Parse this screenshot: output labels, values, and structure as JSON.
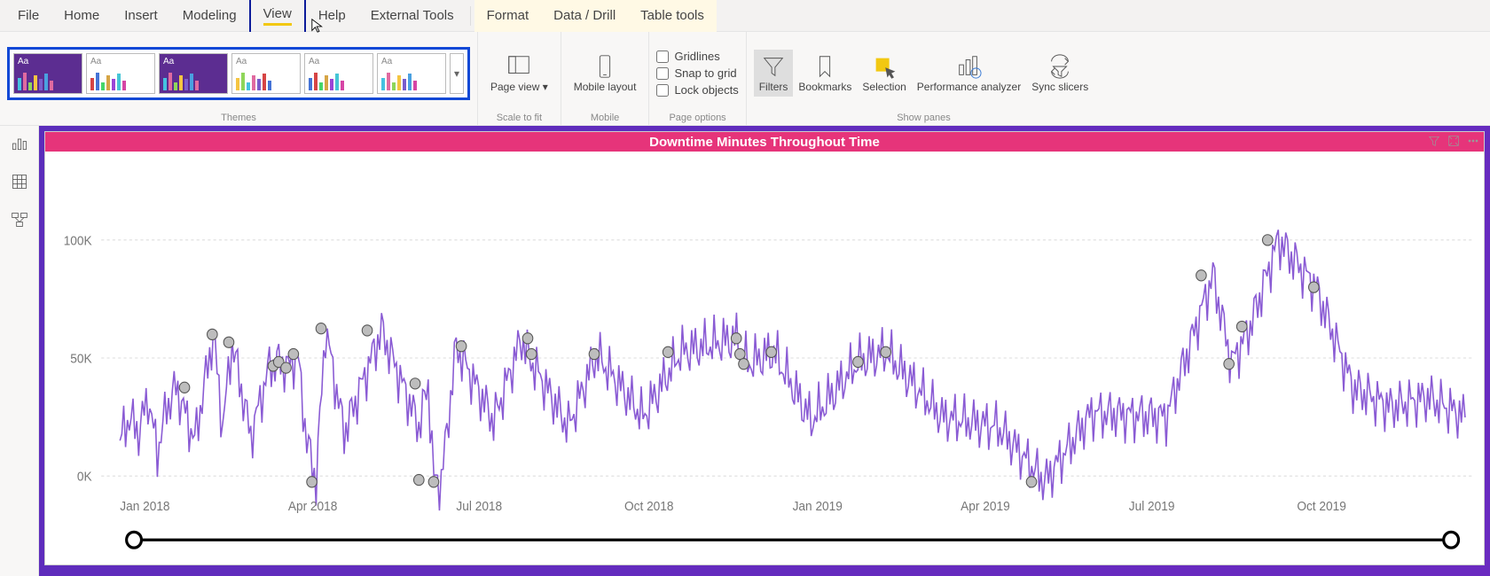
{
  "tabs": {
    "file": "File",
    "home": "Home",
    "insert": "Insert",
    "modeling": "Modeling",
    "view": "View",
    "help": "Help",
    "external": "External Tools",
    "format": "Format",
    "data": "Data / Drill",
    "table": "Table tools"
  },
  "ribbon": {
    "themes_label": "Themes",
    "scale_label": "Scale to fit",
    "mobile_label": "Mobile",
    "page_options_label": "Page options",
    "show_panes_label": "Show panes",
    "page_view": "Page view",
    "mobile_layout": "Mobile layout",
    "gridlines": "Gridlines",
    "snap": "Snap to grid",
    "lock": "Lock objects",
    "filters": "Filters",
    "bookmarks": "Bookmarks",
    "selection": "Selection",
    "perf": "Performance analyzer",
    "sync": "Sync slicers"
  },
  "visual": {
    "title": "Downtime Minutes Throughout Time",
    "y_ticks": [
      "100K",
      "50K",
      "0K"
    ],
    "x_ticks": [
      "Jan 2018",
      "Apr 2018",
      "Jul 2018",
      "Oct 2018",
      "Jan 2019",
      "Apr 2019",
      "Jul 2019",
      "Oct 2019"
    ]
  },
  "themes": {
    "aa": "Aa"
  },
  "chart_data": {
    "type": "line",
    "title": "Downtime Minutes Throughout Time",
    "xlabel": "",
    "ylabel": "",
    "ylim": [
      0,
      120000
    ],
    "x_range": [
      "2018-01-01",
      "2019-12-31"
    ],
    "x_tick_labels": [
      "Jan 2018",
      "Apr 2018",
      "Jul 2018",
      "Oct 2018",
      "Jan 2019",
      "Apr 2019",
      "Jul 2019",
      "Oct 2019"
    ],
    "y_tick_labels": [
      "0K",
      "50K",
      "100K"
    ],
    "series_note": "One noisy daily series with marker dots on anomalies; values estimated from pixel heights.",
    "anomaly_markers": [
      {
        "x": "2018-02-05",
        "y": 45000
      },
      {
        "x": "2018-02-20",
        "y": 72000
      },
      {
        "x": "2018-03-01",
        "y": 68000
      },
      {
        "x": "2018-03-25",
        "y": 56000
      },
      {
        "x": "2018-03-28",
        "y": 58000
      },
      {
        "x": "2018-04-01",
        "y": 55000
      },
      {
        "x": "2018-04-05",
        "y": 62000
      },
      {
        "x": "2018-04-15",
        "y": -3000
      },
      {
        "x": "2018-04-20",
        "y": 75000
      },
      {
        "x": "2018-05-15",
        "y": 74000
      },
      {
        "x": "2018-06-10",
        "y": 47000
      },
      {
        "x": "2018-06-12",
        "y": -2000
      },
      {
        "x": "2018-06-20",
        "y": -3000
      },
      {
        "x": "2018-07-05",
        "y": 66000
      },
      {
        "x": "2018-08-10",
        "y": 70000
      },
      {
        "x": "2018-08-12",
        "y": 62000
      },
      {
        "x": "2018-09-15",
        "y": 62000
      },
      {
        "x": "2018-10-25",
        "y": 63000
      },
      {
        "x": "2018-12-01",
        "y": 70000
      },
      {
        "x": "2018-12-03",
        "y": 62000
      },
      {
        "x": "2018-12-05",
        "y": 57000
      },
      {
        "x": "2018-12-20",
        "y": 63000
      },
      {
        "x": "2019-02-05",
        "y": 58000
      },
      {
        "x": "2019-02-20",
        "y": 63000
      },
      {
        "x": "2019-05-10",
        "y": -3000
      },
      {
        "x": "2019-08-10",
        "y": 102000
      },
      {
        "x": "2019-08-25",
        "y": 57000
      },
      {
        "x": "2019-09-01",
        "y": 76000
      },
      {
        "x": "2019-09-15",
        "y": 120000
      },
      {
        "x": "2019-10-10",
        "y": 96000
      }
    ],
    "series": [
      {
        "name": "Downtime Minutes",
        "color": "#8a5bd4",
        "values_note": "~720 daily points; representative sampled values below (x = day index 0..720, y = minutes).",
        "values": [
          [
            0,
            18000
          ],
          [
            5,
            30000
          ],
          [
            10,
            22000
          ],
          [
            15,
            40000
          ],
          [
            20,
            12000
          ],
          [
            25,
            35000
          ],
          [
            30,
            45000
          ],
          [
            40,
            18000
          ],
          [
            50,
            72000
          ],
          [
            55,
            25000
          ],
          [
            60,
            68000
          ],
          [
            70,
            20000
          ],
          [
            80,
            56000
          ],
          [
            85,
            58000
          ],
          [
            90,
            55000
          ],
          [
            95,
            62000
          ],
          [
            100,
            18000
          ],
          [
            105,
            -3000
          ],
          [
            110,
            75000
          ],
          [
            120,
            22000
          ],
          [
            140,
            74000
          ],
          [
            160,
            25000
          ],
          [
            165,
            47000
          ],
          [
            168,
            -2000
          ],
          [
            172,
            -3000
          ],
          [
            180,
            66000
          ],
          [
            200,
            28000
          ],
          [
            215,
            70000
          ],
          [
            218,
            62000
          ],
          [
            240,
            25000
          ],
          [
            255,
            62000
          ],
          [
            280,
            30000
          ],
          [
            300,
            63000
          ],
          [
            330,
            70000
          ],
          [
            333,
            62000
          ],
          [
            336,
            57000
          ],
          [
            350,
            63000
          ],
          [
            370,
            28000
          ],
          [
            395,
            58000
          ],
          [
            410,
            63000
          ],
          [
            440,
            30000
          ],
          [
            470,
            25000
          ],
          [
            495,
            -3000
          ],
          [
            520,
            32000
          ],
          [
            560,
            30000
          ],
          [
            585,
            102000
          ],
          [
            595,
            57000
          ],
          [
            605,
            76000
          ],
          [
            620,
            120000
          ],
          [
            640,
            96000
          ],
          [
            660,
            45000
          ],
          [
            680,
            35000
          ],
          [
            700,
            40000
          ],
          [
            720,
            30000
          ]
        ]
      }
    ]
  }
}
